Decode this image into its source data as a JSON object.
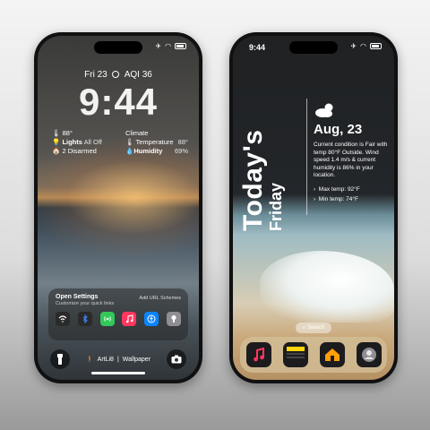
{
  "left_phone": {
    "status": {
      "airplane": "✈",
      "wifi": "wifi-icon"
    },
    "date_line": {
      "day": "Fri 23",
      "aqi": "AQI 36"
    },
    "time": "9:44",
    "widget_home": {
      "temp": "88°",
      "lights_label": "Lights",
      "lights_value": "All Off",
      "disarmed": "2 Disarmed"
    },
    "widget_climate": {
      "title": "Climate",
      "temp_label": "Temperature",
      "temp_value": "88°",
      "humidity_label": "Humidity",
      "humidity_value": "69%"
    },
    "panel": {
      "title": "Open Settings",
      "subtitle": "Customize your quick links",
      "link": "Add URL Schemes",
      "apps": [
        {
          "name": "wifi-icon",
          "color": "#2a2a2a",
          "glyph": "⌔"
        },
        {
          "name": "bluetooth-icon",
          "color": "#2a2a2a",
          "glyph": "ᛒ"
        },
        {
          "name": "cellular-icon",
          "color": "#34c759",
          "glyph": "((•))"
        },
        {
          "name": "music-icon",
          "color": "#ff375f",
          "glyph": "♫"
        },
        {
          "name": "accessibility-icon",
          "color": "#0a84ff",
          "glyph": "ⓘ"
        },
        {
          "name": "tips-icon",
          "color": "#8e8e93",
          "glyph": "💡"
        }
      ]
    },
    "bottom": {
      "artist": "ArtLi8",
      "wallpaper": "Wallpaper"
    }
  },
  "right_phone": {
    "time": "9:44",
    "vertical_big": "Today's",
    "vertical_small": "Friday",
    "weather": {
      "date": "Aug, 23",
      "description": "Current condition is Fair with temp 80°F Outside. Wind speed 1.4 m/s & current humidity is 86% in your location.",
      "max": "Max temp: 92°F",
      "min": "Min temp: 74°F"
    },
    "search": "Search",
    "dock": [
      {
        "name": "music-app-icon",
        "color": "#1c1c1e"
      },
      {
        "name": "notes-app-icon",
        "color": "#1c1c1e"
      },
      {
        "name": "home-app-icon",
        "color": "#1c1c1e"
      },
      {
        "name": "contacts-app-icon",
        "color": "#1c1c1e"
      }
    ]
  }
}
